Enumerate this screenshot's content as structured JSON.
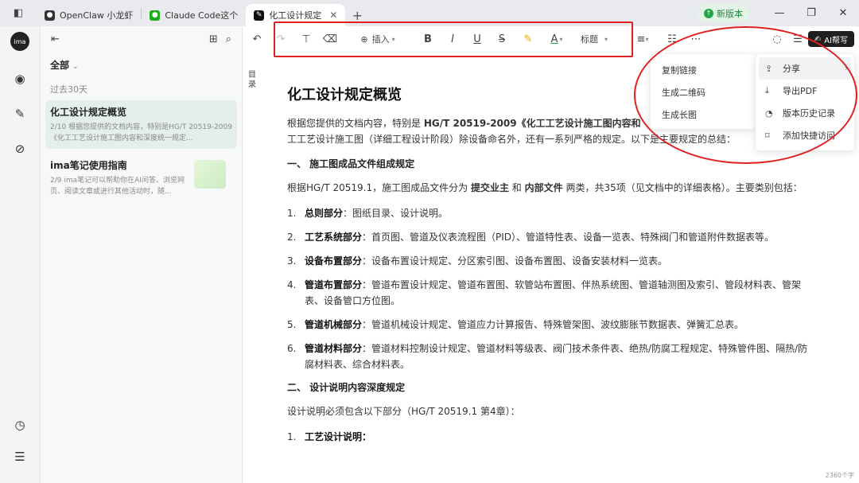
{
  "tabs": [
    {
      "label": "OpenClaw 小龙虾",
      "icon": "openclaw-icon",
      "color": "#333333"
    },
    {
      "label": "Claude Code这个",
      "icon": "wechat-icon",
      "color": "#1aad19"
    },
    {
      "label": "化工设计规定",
      "icon": "ima-icon",
      "color": "#111111"
    }
  ],
  "window": {
    "new_version": "新版本"
  },
  "rail": {
    "avatar": "ima"
  },
  "panel": {
    "filter": "全部",
    "period": "过去30天",
    "notes": [
      {
        "title": "化工设计规定概览",
        "snippet": "2/10 根据您提供的文档内容，特别是HG/T 20519-2009《化工工艺设计施工图内容和深度统一规定..."
      },
      {
        "title": "ima笔记使用指南",
        "snippet": "2/9 ima笔记可以帮助你在AI问答、浏览网页、阅读文章或进行其他活动时，随..."
      }
    ]
  },
  "toolbar": {
    "insert": "插入",
    "heading": "标题",
    "ai_write": "AI帮写"
  },
  "toc_label": "目录",
  "doc": {
    "title": "化工设计规定概览",
    "intro_a": "根据您提供的文档内容，特别是 ",
    "intro_b": "HG/T 20519-2009《化工工艺设计施工图内容和",
    "intro_c": "工工艺设计施工图（详细工程设计阶段）除设备命名外，还有一系列严格的规定。以下是主要规定的总结：",
    "section1": "一、 施工图成品文件组成规定",
    "s1_text_a": "根据HG/T 20519.1，施工图成品文件分为 ",
    "s1_bold_a": "提交业主",
    "s1_text_b": " 和 ",
    "s1_bold_b": "内部文件",
    "s1_text_c": " 两类，共35项（见文档中的详细表格）。主要类别包括：",
    "items": [
      {
        "n": "1.",
        "label": "总则部分",
        "text": "：图纸目录、设计说明。"
      },
      {
        "n": "2.",
        "label": "工艺系统部分",
        "text": "：首页图、管道及仪表流程图（PID）、管道特性表、设备一览表、特殊阀门和管道附件数据表等。"
      },
      {
        "n": "3.",
        "label": "设备布置部分",
        "text": "：设备布置设计规定、分区索引图、设备布置图、设备安装材料一览表。"
      },
      {
        "n": "4.",
        "label": "管道布置部分",
        "text": "：管道布置设计规定、管道布置图、软管站布置图、伴热系统图、管道轴测图及索引、管段材料表、管架表、设备管口方位图。"
      },
      {
        "n": "5.",
        "label": "管道机械部分",
        "text": "：管道机械设计规定、管道应力计算报告、特殊管架图、波纹膨胀节数据表、弹簧汇总表。"
      },
      {
        "n": "6.",
        "label": "管道材料部分",
        "text": "：管道材料控制设计规定、管道材料等级表、阀门技术条件表、绝热/防腐工程规定、特殊管件图、隔热/防腐材料表、综合材料表。"
      }
    ],
    "section2": "二、 设计说明内容深度规定",
    "s2_text": "设计说明必须包含以下部分（HG/T 20519.1 第4章）：",
    "s2_item_n": "1.",
    "s2_item": "工艺设计说明：",
    "wordcount": "2360个字"
  },
  "menu_a": [
    "复制链接",
    "生成二维码",
    "生成长图"
  ],
  "menu_b": [
    {
      "label": "分享",
      "icon": "share-icon"
    },
    {
      "label": "导出PDF",
      "icon": "export-icon"
    },
    {
      "label": "版本历史记录",
      "icon": "history-icon"
    },
    {
      "label": "添加快捷访问",
      "icon": "pin-icon"
    }
  ],
  "colors": {
    "accent_green": "#1a8a3a",
    "annotation_red": "#e02020",
    "selected_note": "#e4efe9"
  }
}
